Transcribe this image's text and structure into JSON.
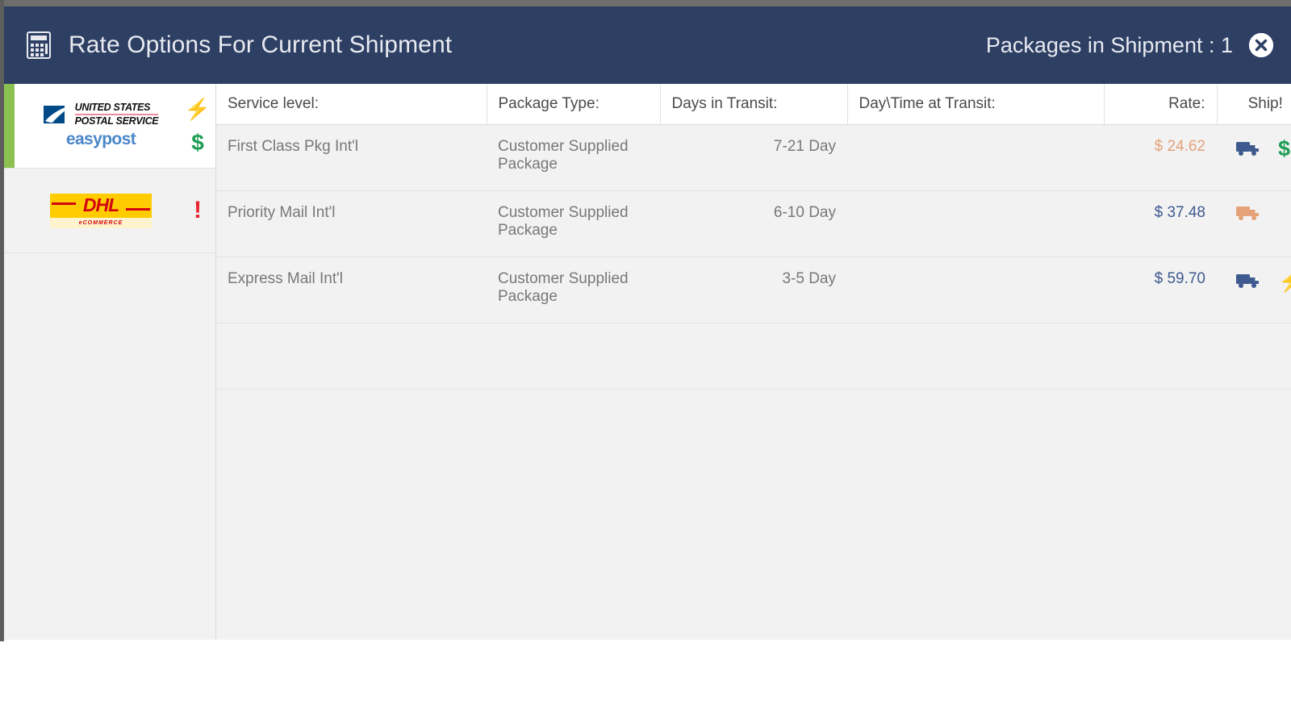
{
  "header": {
    "icon": "calculator-icon",
    "title": "Rate Options For Current Shipment",
    "packages_label": "Packages in Shipment : 1",
    "close_icon": "close-icon",
    "background_color": "#2d3f63",
    "text_color": "#e8eaf0"
  },
  "carriers": [
    {
      "id": "usps-easypost",
      "logo_primary": "usps-logo",
      "logo_line1": "UNITED STATES",
      "logo_line2": "POSTAL SERVICE",
      "logo_secondary_text": "easypost",
      "selected": true,
      "accent_color": "#8cc152",
      "flags": [
        {
          "name": "lightning-bolt-icon",
          "glyph": "⚡",
          "color": "#e3cb1a"
        },
        {
          "name": "dollar-sign-icon",
          "glyph": "$",
          "color": "#1f9d55"
        }
      ]
    },
    {
      "id": "dhl-ecommerce",
      "logo_primary": "dhl-logo",
      "logo_text": "DHL",
      "logo_sub_text": "eCOMMERCE",
      "selected": false,
      "flags": [
        {
          "name": "exclamation-icon",
          "glyph": "!",
          "color": "#e8252a"
        }
      ]
    }
  ],
  "table": {
    "columns": [
      {
        "key": "service",
        "label": "Service level:",
        "align": "left"
      },
      {
        "key": "pkgtype",
        "label": "Package Type:",
        "align": "left"
      },
      {
        "key": "days",
        "label": "Days in Transit:",
        "align": "left"
      },
      {
        "key": "daytime",
        "label": "Day\\Time at Transit:",
        "align": "left"
      },
      {
        "key": "rate",
        "label": "Rate:",
        "align": "right"
      },
      {
        "key": "ship",
        "label": "Ship!",
        "align": "center"
      }
    ],
    "rows": [
      {
        "service": "First Class Pkg Int'l",
        "pkgtype": "Customer Supplied Package",
        "days": "7-21 Day",
        "daytime": "",
        "rate": "$ 24.62",
        "rate_color": "#e5a279",
        "truck_color": "#3f5a8f",
        "extra_icon": "dollar-sign-icon",
        "extra_icon_glyph": "$",
        "extra_icon_color": "#1f9d55"
      },
      {
        "service": "Priority Mail Int'l",
        "pkgtype": "Customer Supplied Package",
        "days": "6-10 Day",
        "daytime": "",
        "rate": "$ 37.48",
        "rate_color": "#3f5a8f",
        "truck_color": "#e5a279",
        "extra_icon": "",
        "extra_icon_glyph": "",
        "extra_icon_color": ""
      },
      {
        "service": "Express Mail Int'l",
        "pkgtype": "Customer Supplied Package",
        "days": "3-5 Day",
        "daytime": "",
        "rate": "$ 59.70",
        "rate_color": "#3f5a8f",
        "truck_color": "#3f5a8f",
        "extra_icon": "lightning-bolt-icon",
        "extra_icon_glyph": "⚡",
        "extra_icon_color": "#e3cb1a"
      }
    ]
  }
}
